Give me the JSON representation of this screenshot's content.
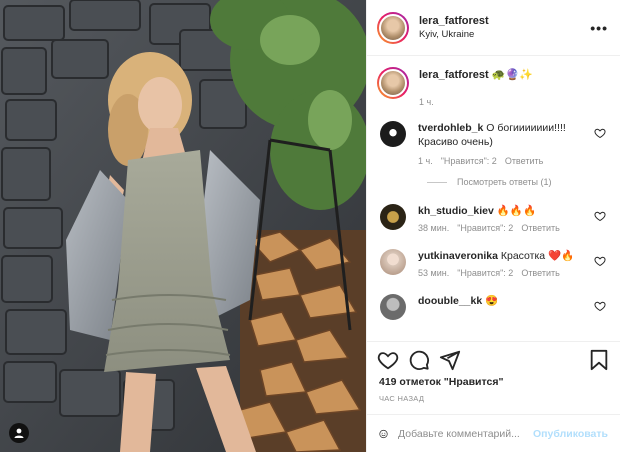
{
  "post": {
    "username": "lera_fatforest",
    "location": "Kyiv, Ukraine",
    "more_label": "•••"
  },
  "caption": {
    "username": "lera_fatforest",
    "emojis": "🐢🔮✨",
    "time": "1 ч."
  },
  "comments": [
    {
      "username": "tverdohleb_k",
      "text": "О богиииииии!!!! Красиво очень)",
      "time": "1 ч.",
      "likes": "\"Нравится\": 2",
      "reply_label": "Ответить",
      "avatar_color": "#1c1c1c"
    },
    {
      "username": "kh_studio_kiev",
      "text": "🔥🔥🔥",
      "time": "38 мин.",
      "likes": "\"Нравится\": 2",
      "reply_label": "Ответить",
      "avatar_color": "#2b2416"
    },
    {
      "username": "yutkinaveronika",
      "text": "Красотка ❤️🔥",
      "time": "53 мин.",
      "likes": "\"Нравится\": 2",
      "reply_label": "Ответить",
      "avatar_color": "#d9c6b8"
    },
    {
      "username": "doouble__kk",
      "text": "😍",
      "time": "",
      "likes": "",
      "reply_label": "",
      "avatar_color": "#6b6b6b"
    }
  ],
  "replies_label": "Посмотреть ответы (1)",
  "likes_text": "419 отметок \"Нравится\"",
  "time_ago": "ЧАС НАЗАД",
  "add_comment": {
    "placeholder": "Добавьте комментарий...",
    "publish_label": "Опубликовать"
  },
  "colors": {
    "publish_disabled": "#b2dffc",
    "meta_gray": "#8e8e8e",
    "border": "#efefef"
  },
  "icons": [
    "heart-icon",
    "comment-icon",
    "share-icon",
    "bookmark-icon",
    "emoji-icon",
    "more-icon",
    "user-tag-icon"
  ]
}
